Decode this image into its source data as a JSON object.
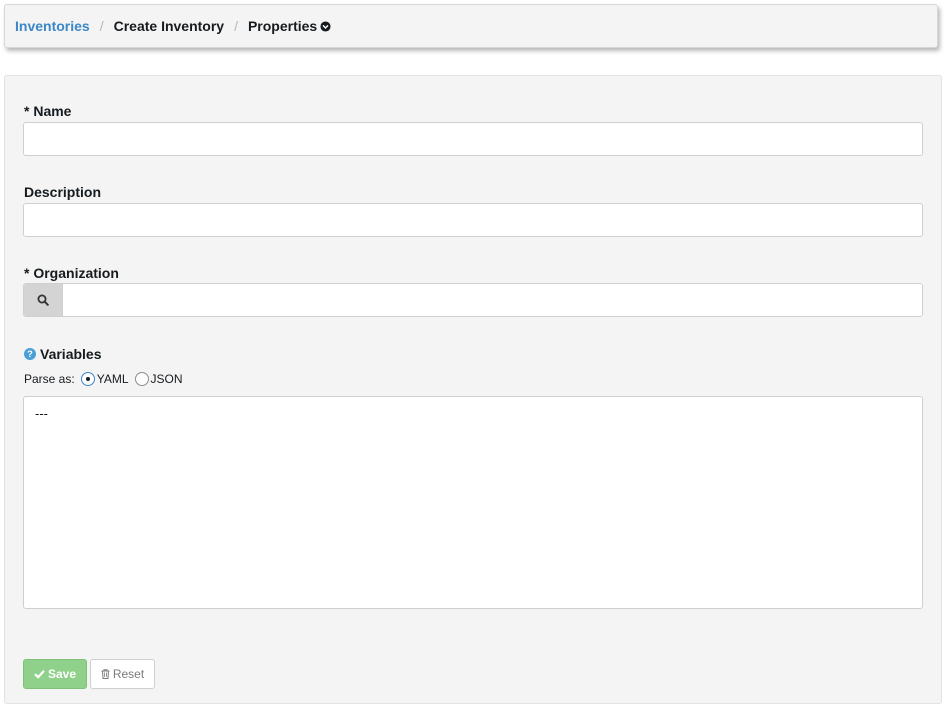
{
  "breadcrumb": {
    "items": [
      "Inventories",
      "Create Inventory",
      "Properties"
    ],
    "separator": "/"
  },
  "form": {
    "name_label": "* Name",
    "name_value": "",
    "description_label": "Description",
    "description_value": "",
    "organization_label": "* Organization",
    "organization_value": "",
    "variables_label": "Variables",
    "parse_as_label": "Parse as:",
    "parse_options": [
      "YAML",
      "JSON"
    ],
    "parse_selected": "YAML",
    "variables_value": "---"
  },
  "buttons": {
    "save_label": "Save",
    "reset_label": "Reset"
  },
  "icons": {
    "properties_toggle": "chevron-circle-down-icon",
    "organization_lookup": "search-icon",
    "variables_help": "question-circle-icon",
    "save": "check-icon",
    "reset": "trash-icon"
  },
  "colors": {
    "link": "#3c87c8",
    "save_button": "#8fd18a",
    "help_icon": "#4a9fd6",
    "panel_bg": "#f4f4f4"
  }
}
